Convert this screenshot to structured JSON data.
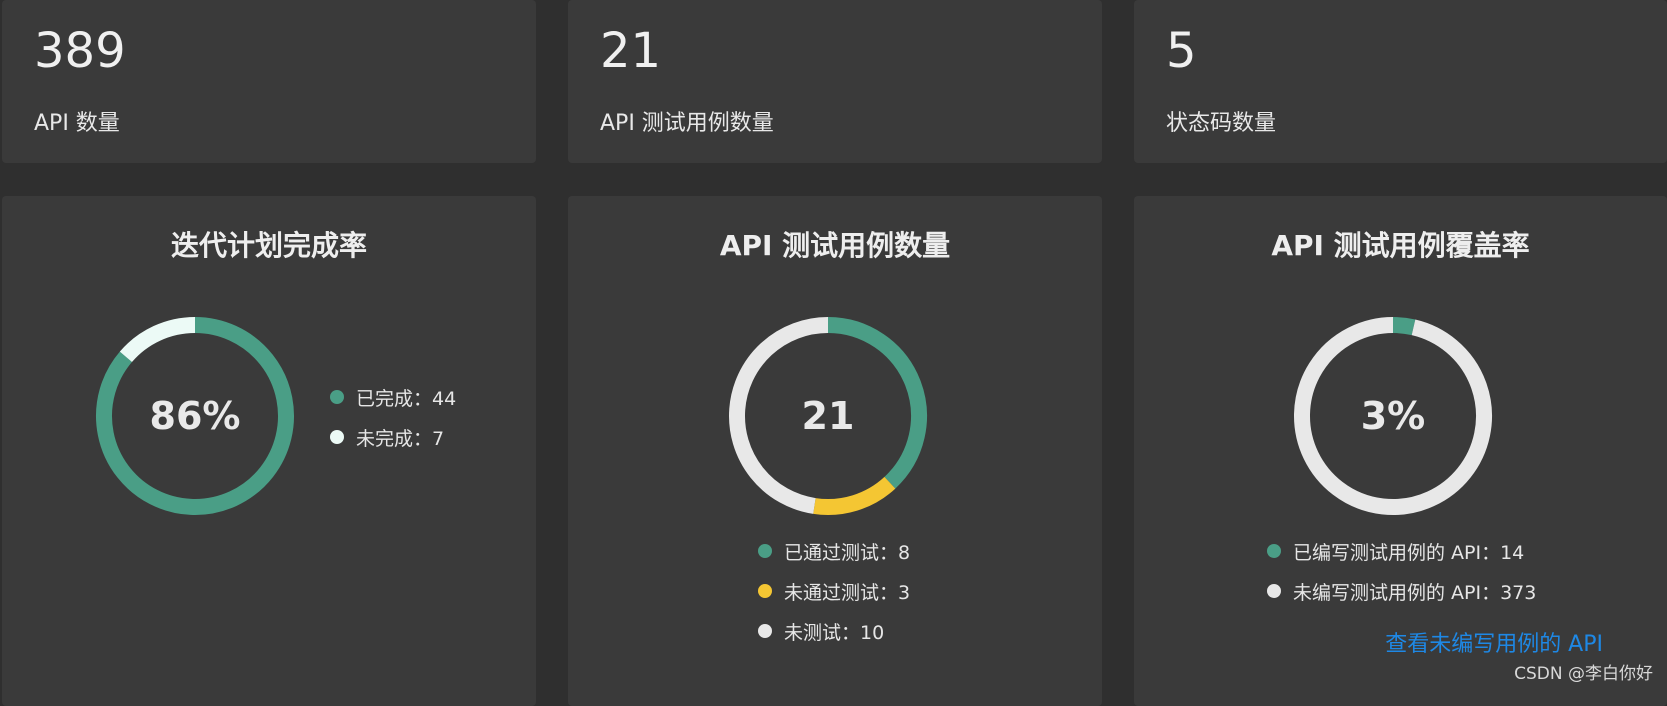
{
  "stats": [
    {
      "value": "389",
      "label": "API 数量"
    },
    {
      "value": "21",
      "label": "API 测试用例数量"
    },
    {
      "value": "5",
      "label": "状态码数量"
    }
  ],
  "charts": [
    {
      "title": "迭代计划完成率",
      "center": "86%",
      "segments": [
        {
          "label": "已完成：44",
          "value": 44,
          "color": "#4a9e86"
        },
        {
          "label": "未完成：7",
          "value": 7,
          "color": "#ecfaf6"
        }
      ]
    },
    {
      "title": "API 测试用例数量",
      "center": "21",
      "segments": [
        {
          "label": "已通过测试：8",
          "value": 8,
          "color": "#4a9e86"
        },
        {
          "label": "未通过测试：3",
          "value": 3,
          "color": "#f4c633"
        },
        {
          "label": "未测试：10",
          "value": 10,
          "color": "#e8e8e8"
        }
      ]
    },
    {
      "title": "API 测试用例覆盖率",
      "center": "3%",
      "segments": [
        {
          "label": "已编写测试用例的 API：14",
          "value": 14,
          "color": "#4a9e86"
        },
        {
          "label": "未编写测试用例的 API：373",
          "value": 373,
          "color": "#e8e8e8"
        }
      ],
      "link": "查看未编写用例的 API"
    }
  ],
  "watermark": "CSDN @李白你好"
}
